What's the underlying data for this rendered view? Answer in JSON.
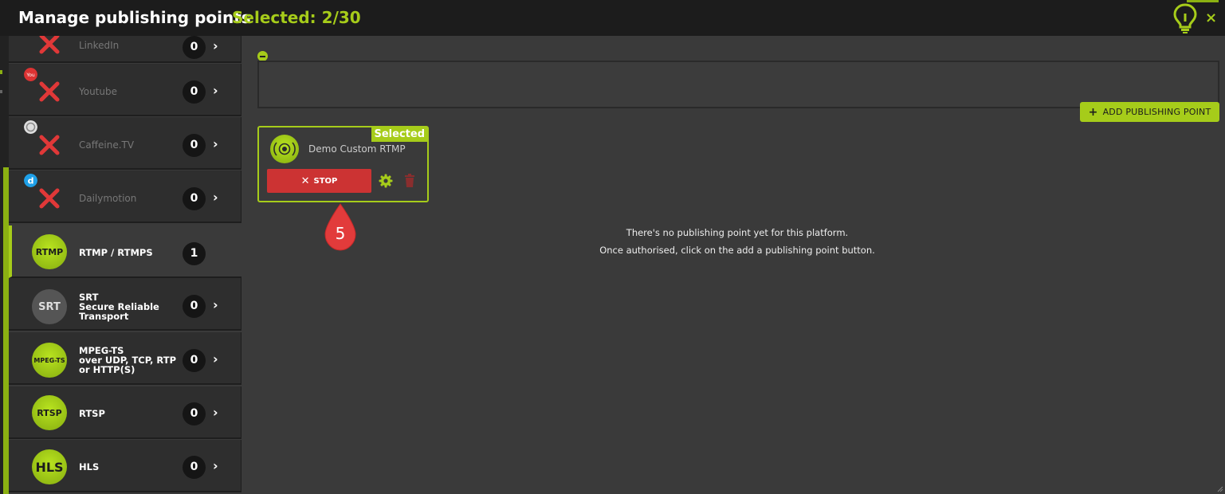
{
  "header": {
    "title": "Manage publishing points",
    "selected": "Selected: 2/30",
    "close_label": "×"
  },
  "sidebar": {
    "items": [
      {
        "label": "LinkedIn",
        "count": "0",
        "icon": "linkedin-icon"
      },
      {
        "label": "Youtube",
        "count": "0",
        "icon": "youtube-icon"
      },
      {
        "label": "Caffeine.TV",
        "count": "0",
        "icon": "caffeine-icon"
      },
      {
        "label": "Dailymotion",
        "count": "0",
        "icon": "dailymotion-icon"
      },
      {
        "label": "RTMP / RTMPS",
        "count": "1",
        "disc": "RTMP",
        "active": true
      },
      {
        "label_lines": [
          "SRT",
          "Secure Reliable",
          "Transport"
        ],
        "count": "0",
        "disc": "SRT"
      },
      {
        "label_lines": [
          "MPEG-TS",
          "over UDP, TCP, RTP",
          "or HTTP(S)"
        ],
        "count": "0",
        "disc": "MPEG-TS"
      },
      {
        "label": "RTSP",
        "count": "0",
        "disc": "RTSP"
      },
      {
        "label": "HLS",
        "count": "0",
        "disc": "HLS"
      }
    ]
  },
  "main": {
    "add_button": "ADD PUBLISHING POINT",
    "card": {
      "badge": "Selected",
      "name": "Demo Custom RTMP",
      "stop_label": "STOP"
    },
    "callout_number": "5",
    "empty_line1": "There's no publishing point yet for this platform.",
    "empty_line2": "Once authorised, click on the add a publishing point button."
  },
  "colors": {
    "accent": "#a6cc1a",
    "danger": "#cc3333",
    "background": "#3a3a3a"
  }
}
